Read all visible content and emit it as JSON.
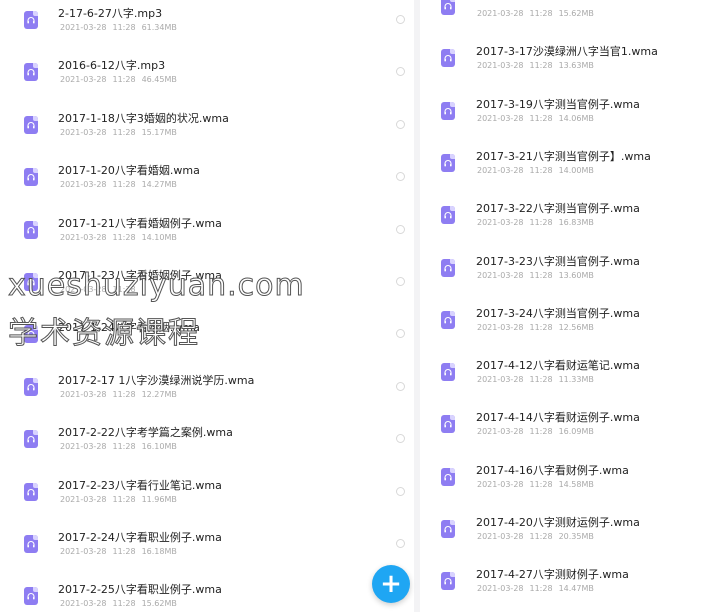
{
  "colors": {
    "icon": "#8e7df2",
    "fab": "#1fa6f3",
    "meta": "#aaaaaa"
  },
  "left_list": [
    {
      "name": "2-17-6-27八字.mp3",
      "date": "2021-03-28",
      "time": "11:28",
      "size": "61.34MB"
    },
    {
      "name": "2016-6-12八字.mp3",
      "date": "2021-03-28",
      "time": "11:28",
      "size": "46.45MB"
    },
    {
      "name": "2017-1-18八字3婚姻的状况.wma",
      "date": "2021-03-28",
      "time": "11:28",
      "size": "15.17MB"
    },
    {
      "name": "2017-1-20八字看婚姻.wma",
      "date": "2021-03-28",
      "time": "11:28",
      "size": "14.27MB"
    },
    {
      "name": "2017-1-21八字看婚姻例子.wma",
      "date": "2021-03-28",
      "time": "11:28",
      "size": "14.10MB"
    },
    {
      "name": "2017-1-23八字看婚姻例子.wma",
      "date": "2021-03-28",
      "time": "11:28",
      "size": ""
    },
    {
      "name": "2017-1-24八字看婚姻.wma",
      "date": "",
      "time": "",
      "size": ""
    },
    {
      "name": "2017-2-17 1八字沙漠绿洲说学历.wma",
      "date": "2021-03-28",
      "time": "11:28",
      "size": "12.27MB"
    },
    {
      "name": "2017-2-22八字考学篇之案例.wma",
      "date": "2021-03-28",
      "time": "11:28",
      "size": "16.10MB"
    },
    {
      "name": "2017-2-23八字看行业笔记.wma",
      "date": "2021-03-28",
      "time": "11:28",
      "size": "11.96MB"
    },
    {
      "name": "2017-2-24八字看职业例子.wma",
      "date": "2021-03-28",
      "time": "11:28",
      "size": "16.18MB"
    },
    {
      "name": "2017-2-25八字看职业例子.wma",
      "date": "2021-03-28",
      "time": "11:28",
      "size": "15.62MB"
    }
  ],
  "right_list": [
    {
      "name": "",
      "date": "2021-03-28",
      "time": "11:28",
      "size": "15.62MB"
    },
    {
      "name": "2017-3-17沙漠绿洲八字当官1.wma",
      "date": "2021-03-28",
      "time": "11:28",
      "size": "13.63MB"
    },
    {
      "name": "2017-3-19八字测当官例子.wma",
      "date": "2021-03-28",
      "time": "11:28",
      "size": "14.06MB"
    },
    {
      "name": "2017-3-21八字测当官例子】.wma",
      "date": "2021-03-28",
      "time": "11:28",
      "size": "14.00MB"
    },
    {
      "name": "2017-3-22八字测当官例子.wma",
      "date": "2021-03-28",
      "time": "11:28",
      "size": "16.83MB"
    },
    {
      "name": "2017-3-23八字测当官例子.wma",
      "date": "2021-03-28",
      "time": "11:28",
      "size": "13.60MB"
    },
    {
      "name": "2017-3-24八字测当官例子.wma",
      "date": "2021-03-28",
      "time": "11:28",
      "size": "12.56MB"
    },
    {
      "name": "2017-4-12八字看财运笔记.wma",
      "date": "2021-03-28",
      "time": "11:28",
      "size": "11.33MB"
    },
    {
      "name": "2017-4-14八字看财运例子.wma",
      "date": "2021-03-28",
      "time": "11:28",
      "size": "16.09MB"
    },
    {
      "name": "2017-4-16八字看财例子.wma",
      "date": "2021-03-28",
      "time": "11:28",
      "size": "14.58MB"
    },
    {
      "name": "2017-4-20八字测财运例子.wma",
      "date": "2021-03-28",
      "time": "11:28",
      "size": "20.35MB"
    },
    {
      "name": "2017-4-27八字测财例子.wma",
      "date": "2021-03-28",
      "time": "11:28",
      "size": "14.47MB"
    }
  ],
  "fab": {
    "label": "+",
    "icon": "plus-icon"
  },
  "watermark": {
    "line1": "xueshuziyuan.com",
    "line2": "学术资源课程"
  }
}
